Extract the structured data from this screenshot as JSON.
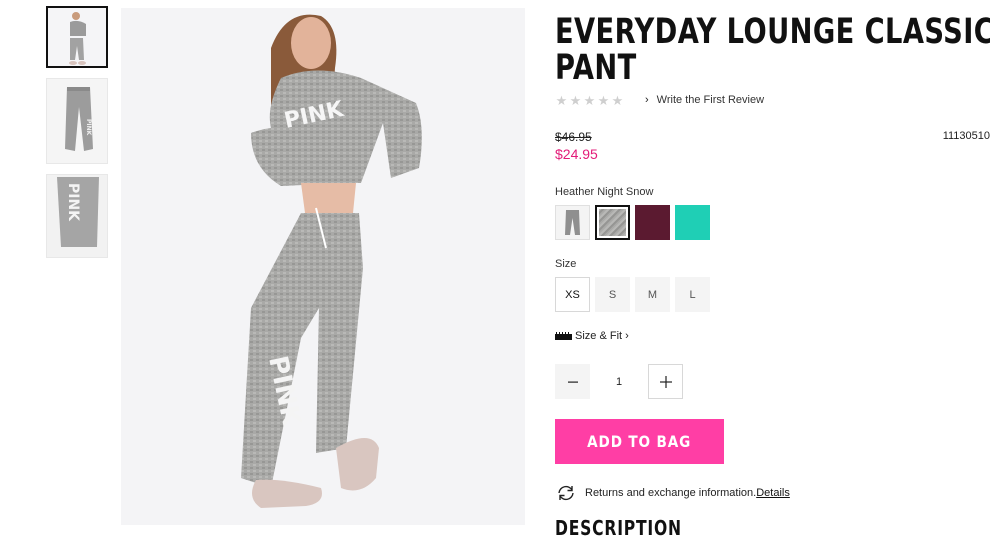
{
  "product": {
    "title_line1": "EVERYDAY LOUNGE CLASSIC",
    "title_line2": "PANT",
    "rating": {
      "stars_filled": 0,
      "stars_total": 5,
      "review_link": "Write the First Review"
    },
    "price_original": "$46.95",
    "price_sale": "$24.95",
    "sku": "11130510"
  },
  "gallery": {
    "thumbnails": [
      {
        "name": "model-full-body",
        "active": true
      },
      {
        "name": "pant-flat-front",
        "active": false
      },
      {
        "name": "pant-leg-detail",
        "active": false
      }
    ],
    "main_image": "model-full-body"
  },
  "color": {
    "selected_name": "Heather Night Snow",
    "swatches": [
      {
        "name": "pant-thumbnail",
        "hex": "#9a9a9a",
        "selected": false
      },
      {
        "name": "heather-night-snow",
        "hex": "#a8a8a6",
        "selected": true
      },
      {
        "name": "burgundy",
        "hex": "#5b1a30",
        "selected": false
      },
      {
        "name": "teal",
        "hex": "#1fcfb5",
        "selected": false
      }
    ]
  },
  "size": {
    "label": "Size",
    "options": [
      {
        "label": "XS",
        "selected": true
      },
      {
        "label": "S",
        "selected": false
      },
      {
        "label": "M",
        "selected": false
      },
      {
        "label": "L",
        "selected": false
      }
    ],
    "fit_link": "Size & Fit"
  },
  "quantity": {
    "value": "1",
    "minus_symbol": "−",
    "plus_symbol": "+"
  },
  "actions": {
    "add_to_bag": "ADD TO BAG"
  },
  "returns": {
    "text": "Returns and exchange information.",
    "link": "Details"
  },
  "description": {
    "heading": "DESCRIPTION"
  },
  "colors": {
    "accent_pink": "#ff3ea5",
    "sale_price": "#e31c79",
    "text": "#222222"
  }
}
